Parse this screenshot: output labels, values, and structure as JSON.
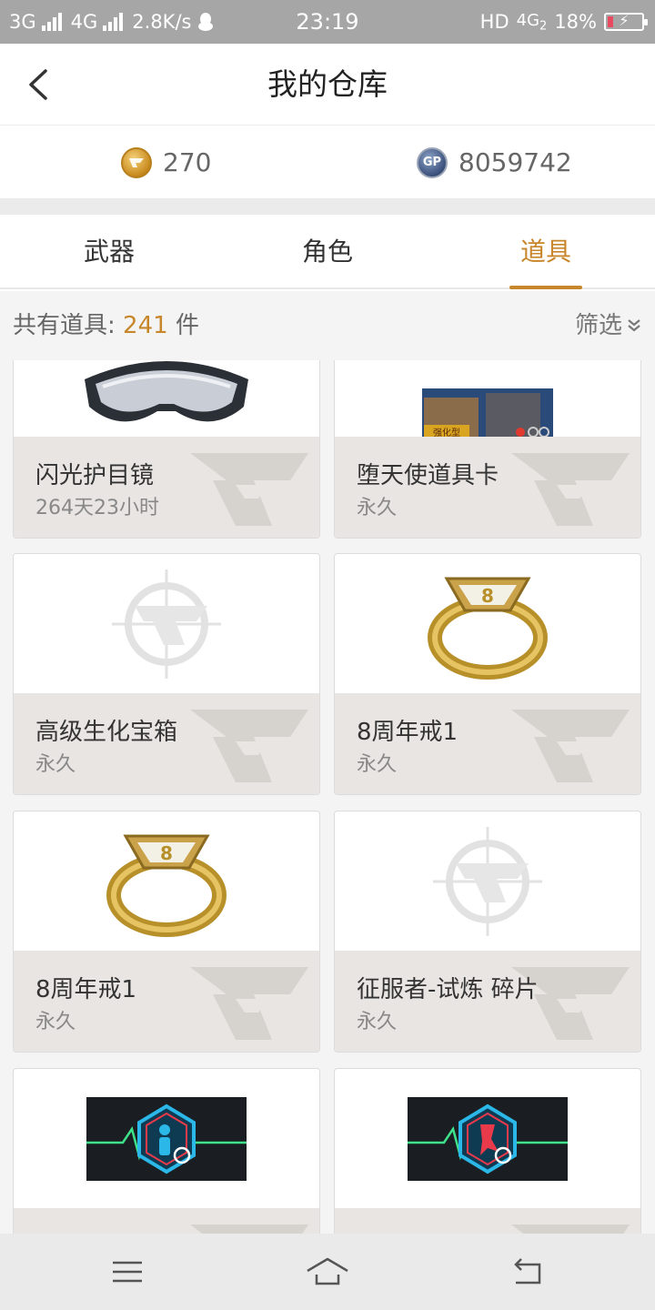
{
  "status_bar": {
    "net1": "3G",
    "net2": "4G",
    "speed": "2.8K/s",
    "time": "23:19",
    "hd": "HD",
    "net3": "4G",
    "sim": "2",
    "battery": "18%"
  },
  "header": {
    "title": "我的仓库"
  },
  "currency": {
    "cf_amount": "270",
    "gp_icon_text": "GP",
    "gp_amount": "8059742"
  },
  "tabs": [
    {
      "label": "武器"
    },
    {
      "label": "角色"
    },
    {
      "label": "道具"
    }
  ],
  "active_tab": 2,
  "count_row": {
    "prefix": "共有道具:",
    "count": "241",
    "unit": "件",
    "filter_label": "筛选"
  },
  "items": [
    {
      "name": "闪光护目镜",
      "duration": "264天23小时",
      "image": "goggles-image"
    },
    {
      "name": "堕天使道具卡",
      "duration": "永久",
      "image": "item-card-image",
      "card_text": "强化型"
    },
    {
      "name": "高级生化宝箱",
      "duration": "永久",
      "image": "cf-placeholder-image"
    },
    {
      "name": "8周年戒1",
      "duration": "永久",
      "image": "ring-image"
    },
    {
      "name": "8周年戒1",
      "duration": "永久",
      "image": "ring-image"
    },
    {
      "name": "征服者-试炼 碎片",
      "duration": "永久",
      "image": "cf-placeholder-image"
    },
    {
      "name": "",
      "duration": "",
      "image": "heartbeat-card-image"
    },
    {
      "name": "",
      "duration": "",
      "image": "heartbeat-card-image"
    }
  ],
  "colors": {
    "accent": "#c8862b",
    "info_bg": "#e8e5e2",
    "page_bg": "#f4f4f4"
  }
}
